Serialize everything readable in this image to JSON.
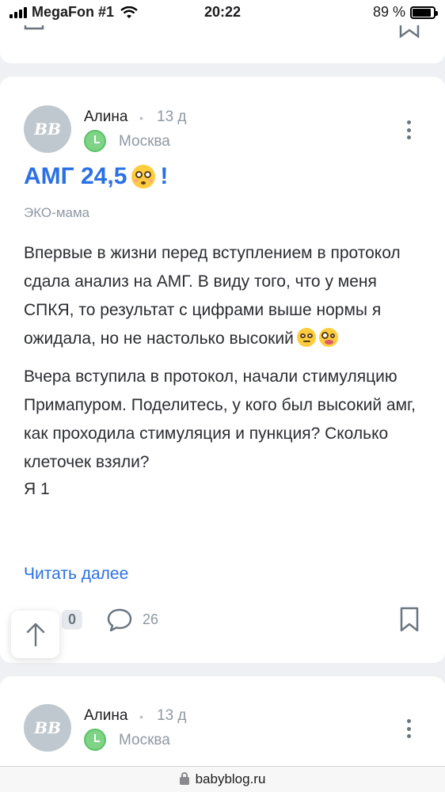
{
  "status_bar": {
    "carrier": "MegaFon #1",
    "time": "20:22",
    "battery_percent": "89 %",
    "battery_level": 0.89
  },
  "posts": [
    {
      "author": "Алина",
      "time_ago": "13 д",
      "city": "Москва",
      "avatar_initials": "ВВ",
      "title": "АМГ 24,5",
      "title_suffix": "!",
      "community": "ЭКО-мама",
      "body_p1": "Впервые в жизни перед вступлением в протокол сдала анализ на АМГ. В виду того, что у меня СПКЯ, то результат с цифрами выше нормы я ожидала, но не настолько высокий",
      "body_p2": "Вчера вступила в протокол, начали стимуляцию Примапуром. Поделитесь, у кого был высокий амг, как проходила стимуляция и пункция? Сколько клеточек взяли?",
      "body_p3": "Я 1",
      "read_more": "Читать далее",
      "likes": "0",
      "comments": "26"
    },
    {
      "author": "Алина",
      "time_ago": "13 д",
      "city": "Москва",
      "avatar_initials": "ВВ"
    }
  ],
  "browser": {
    "url": "babyblog.ru"
  },
  "icons": {
    "signal": "signal-icon",
    "wifi": "wifi-icon",
    "battery": "battery-icon",
    "city": "clock-icon",
    "more": "more-vertical-icon",
    "like": "like-icon",
    "comment": "comment-icon",
    "bookmark": "bookmark-icon",
    "scroll_top": "arrow-up-icon",
    "lock": "lock-icon"
  },
  "colors": {
    "accent": "#2b70e4",
    "muted": "#8f98a3",
    "background": "#eef0f3",
    "city_badge": "#7ed387"
  }
}
